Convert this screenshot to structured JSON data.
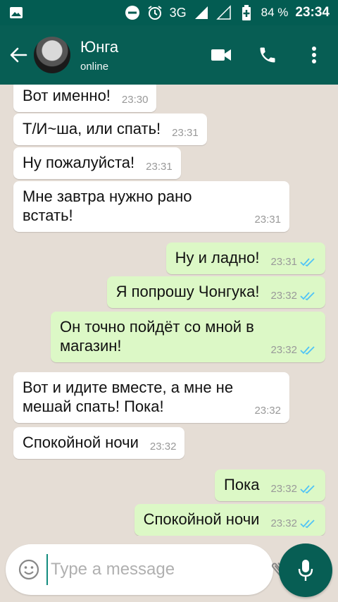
{
  "status_bar": {
    "network": "3G",
    "network_small": "3G",
    "battery": "84 %",
    "time": "23:34"
  },
  "header": {
    "contact_name": "Юнга",
    "contact_status": "online"
  },
  "messages": [
    {
      "dir": "in",
      "text": "Вот именно!",
      "time": "23:30"
    },
    {
      "dir": "in",
      "text": "Т/И~ша, или спать!",
      "time": "23:31"
    },
    {
      "dir": "in",
      "text": "Ну пожалуйста!",
      "time": "23:31"
    },
    {
      "dir": "in",
      "text": "Мне завтра нужно рано\nвстать!",
      "time": "23:31"
    },
    {
      "dir": "out",
      "text": "Ну и ладно!",
      "time": "23:31"
    },
    {
      "dir": "out",
      "text": "Я попрошу Чонгука!",
      "time": "23:32"
    },
    {
      "dir": "out",
      "text": "Он точно пойдёт со мной в\nмагазин!",
      "time": "23:32"
    },
    {
      "dir": "in",
      "text": "Вот и идите вместе, а мне не\nмешай спать! Пока!",
      "time": "23:32"
    },
    {
      "dir": "in",
      "text": "Спокойной ночи",
      "time": "23:32"
    },
    {
      "dir": "out",
      "text": "Пока",
      "time": "23:32"
    },
    {
      "dir": "out",
      "text": "Спокойной ночи",
      "time": "23:32"
    }
  ],
  "input": {
    "placeholder": "Type a message",
    "value": ""
  },
  "colors": {
    "header": "#075e54",
    "status_bar": "#035c52",
    "outgoing_bubble": "#dcf8c6",
    "incoming_bubble": "#ffffff",
    "read_ticks": "#4fc3f7"
  }
}
